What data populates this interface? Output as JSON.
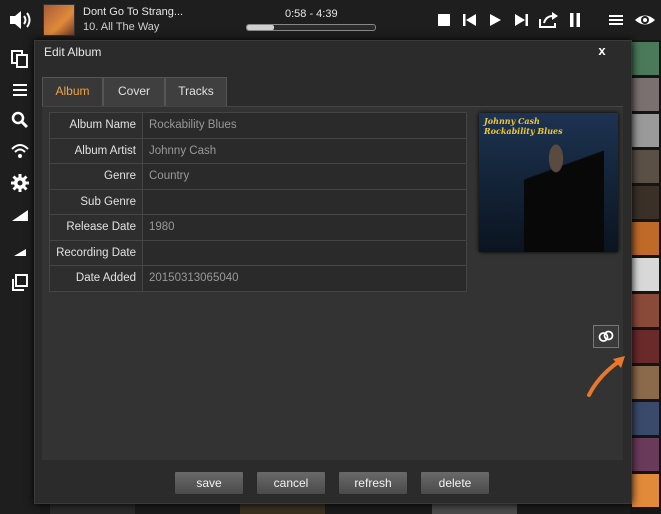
{
  "now_playing": {
    "title": "Dont Go To Strang...",
    "track": "10. All The Way",
    "time": "0:58 - 4:39",
    "progress_fraction": 0.21
  },
  "icons": {
    "volume": "volume-icon",
    "stop": "stop-icon",
    "prev": "skip-back-icon",
    "play": "play-icon",
    "next": "skip-forward-icon",
    "share": "share-icon",
    "pause": "pause-icon",
    "menu": "menu-icon",
    "eye": "eye-icon",
    "copy": "copy-icon",
    "list": "list-icon",
    "search": "search-icon",
    "wifi": "wifi-icon",
    "settings": "gear-icon",
    "signal": "signal-icon",
    "signal_small": "signal-small-icon",
    "windows": "windows-icon",
    "link": "link-icon",
    "close": "close-icon"
  },
  "dialog": {
    "title": "Edit Album",
    "close_label": "x",
    "tabs": [
      {
        "label": "Album",
        "active": true
      },
      {
        "label": "Cover",
        "active": false
      },
      {
        "label": "Tracks",
        "active": false
      }
    ],
    "fields": [
      {
        "label": "Album Name",
        "value": "Rockability Blues"
      },
      {
        "label": "Album Artist",
        "value": "Johnny Cash"
      },
      {
        "label": "Genre",
        "value": "Country"
      },
      {
        "label": "Sub Genre",
        "value": ""
      },
      {
        "label": "Release Date",
        "value": "1980"
      },
      {
        "label": "Recording Date",
        "value": ""
      },
      {
        "label": "Date Added",
        "value": "20150313065040"
      }
    ],
    "cover": {
      "artist_text": "Johnny Cash",
      "title_text": "Rockability Blues"
    },
    "buttons": {
      "save": "save",
      "cancel": "cancel",
      "refresh": "refresh",
      "delete": "delete"
    }
  },
  "colors": {
    "accent_tab": "#f0a24a",
    "arrow": "#e8782a",
    "cover_text": "#f0c830"
  }
}
